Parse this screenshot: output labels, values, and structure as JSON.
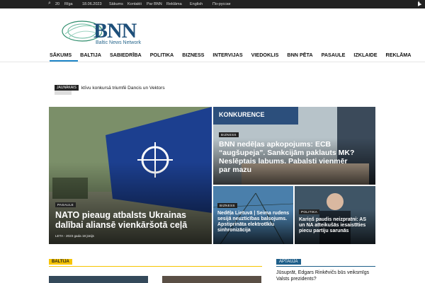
{
  "topbar": {
    "temp": "20",
    "city": "Rīga",
    "date": "18.06.2023",
    "links": [
      "Sākums",
      "Kontakti",
      "Par BNN",
      "Reklāma"
    ],
    "lang1": "English",
    "lang2": "По-русски"
  },
  "logo": {
    "title": "BNN",
    "subtitle": "Baltic News Network"
  },
  "nav": [
    "SĀKUMS",
    "BALTIJA",
    "SABIEDRĪBA",
    "POLITIKA",
    "BIZNESS",
    "INTERVIJAS",
    "VIEDOKLIS",
    "BNN PĒTA",
    "PASAULE",
    "IZKLAIDE",
    "REKLĀMA"
  ],
  "ticker": {
    "tag": "JAUNĀKAIS",
    "text": "ktīvu konkursā triumfē Dancis un Vektors"
  },
  "tiles": {
    "main": {
      "category": "PASAULE",
      "title": "NATO pieaug atbalsts Ukrainas dalībai aliansē vienkāršotā ceļā",
      "meta": "LETA  -  2023 gada 18 jūnijs"
    },
    "top_right": {
      "category": "BIZNESS",
      "title": "BNN nedēļas apkopojums: ECB “augšupeja”. Sankcijām paklauts MK? Neslēptais labums. Pabalsti vienmēr par mazu",
      "image_text": "KONKURENCE"
    },
    "bottom_left": {
      "category": "BIZNESS",
      "title": "Nedēļa Lietuvā | Seima rudens sesijā neuzticības balsojums. Apstiprināta elektrotīklu sinhronizācija"
    },
    "bottom_right": {
      "category": "POLITIKA",
      "title": "Kariņš paudis neizpratni: AS un NA atteikušās iesaistīties piecu partiju sarunās"
    }
  },
  "sections": {
    "baltija": "BALTIJA",
    "aptauja": "APTAUJA"
  },
  "poll": {
    "question": "Jūsuprāt, Edgars Rinkēvičs būs veiksmīgs Valsts prezidents?"
  },
  "colors": {
    "accent": "#1f86c8",
    "topbar": "#222222",
    "section": "#f6c400",
    "poll": "#1f5f8a"
  }
}
